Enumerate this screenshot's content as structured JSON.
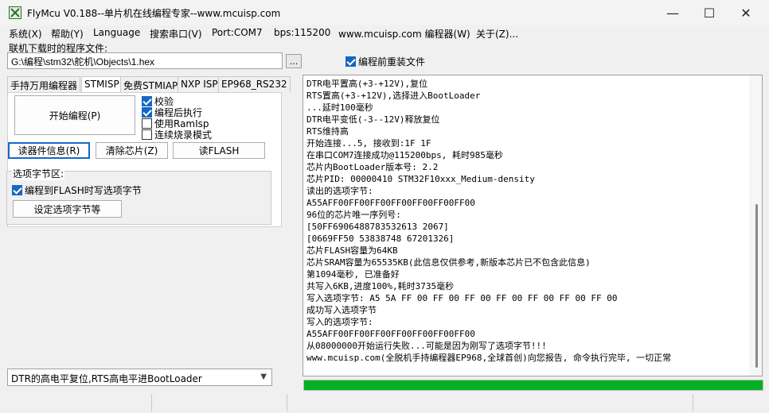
{
  "window": {
    "title": "FlyMcu V0.188--单片机在线编程专家--www.mcuisp.com",
    "minimize_glyph": "—",
    "maximize_glyph": "☐",
    "close_glyph": "✕",
    "icon": "flymcu-app-icon"
  },
  "menu": [
    "系统(X)",
    "帮助(Y)",
    "Language",
    "搜索串口(V)",
    "Port:COM7",
    "bps:115200",
    "www.mcuisp.com 编程器(W)",
    "关于(Z)..."
  ],
  "file": {
    "label": "联机下载时的程序文件:",
    "path": "G:\\编程\\stm32\\舵机\\Objects\\1.hex",
    "browse_label": "..."
  },
  "reload_before_program": {
    "label": "编程前重装文件",
    "checked": true
  },
  "tabs": [
    {
      "label": "手持万用编程器",
      "active": false
    },
    {
      "label": "STMISP",
      "active": true
    },
    {
      "label": "免费STMIAP",
      "active": false
    },
    {
      "label": "NXP ISP",
      "active": false
    },
    {
      "label": "EP968_RS232",
      "active": false
    }
  ],
  "panel": {
    "start_button": "开始编程(P)",
    "options": [
      {
        "label": "校验",
        "checked": true
      },
      {
        "label": "编程后执行",
        "checked": true
      },
      {
        "label": "使用RamIsp",
        "checked": false
      },
      {
        "label": "连续烧录模式",
        "checked": false
      }
    ],
    "read_info_button": "读器件信息(R)",
    "erase_button": "清除芯片(Z)",
    "read_flash_button": "读FLASH"
  },
  "option_bytes": {
    "group_label": "选项字节区:",
    "write_on_program": {
      "label": "编程到FLASH时写选项字节",
      "checked": true
    },
    "set_button": "设定选项字节等"
  },
  "boot_mode_select": "DTR的高电平复位,RTS高电平进BootLoader",
  "log": [
    "DTR电平置高(+3-+12V),复位",
    "RTS置高(+3-+12V),选择进入BootLoader",
    "...延时100毫秒",
    "DTR电平变低(-3--12V)释放复位",
    "RTS维持高",
    "开始连接...5, 接收到:1F 1F",
    "在串口COM7连接成功@115200bps, 耗时985毫秒",
    "芯片内BootLoader版本号: 2.2",
    "芯片PID: 00000410  STM32F10xxx_Medium-density",
    "读出的选项字节:",
    "A55AFF00FF00FF00FF00FF00FF00FF00",
    "96位的芯片唯一序列号:",
    "[50FF6906488783532613 2067]",
    "[0669FF50 53838748 67201326]",
    "芯片FLASH容量为64KB",
    "芯片SRAM容量为65535KB(此信息仅供参考,新版本芯片已不包含此信息)",
    "第1094毫秒, 已准备好",
    "共写入6KB,进度100%,耗时3735毫秒",
    "写入选项字节:  A5 5A FF 00 FF 00 FF 00 FF 00 FF 00 FF 00 FF 00",
    "成功写入选项字节",
    "写入的选项字节:",
    "A55AFF00FF00FF00FF00FF00FF00FF00",
    "从08000000开始运行失败...可能是因为刚写了选项字节!!!",
    "www.mcuisp.com(全脱机手持编程器EP968,全球首创)向您报告, 命令执行完毕, 一切正常"
  ],
  "progress_percent": 100,
  "colors": {
    "accent": "#1667c4",
    "progress": "#06b025"
  }
}
